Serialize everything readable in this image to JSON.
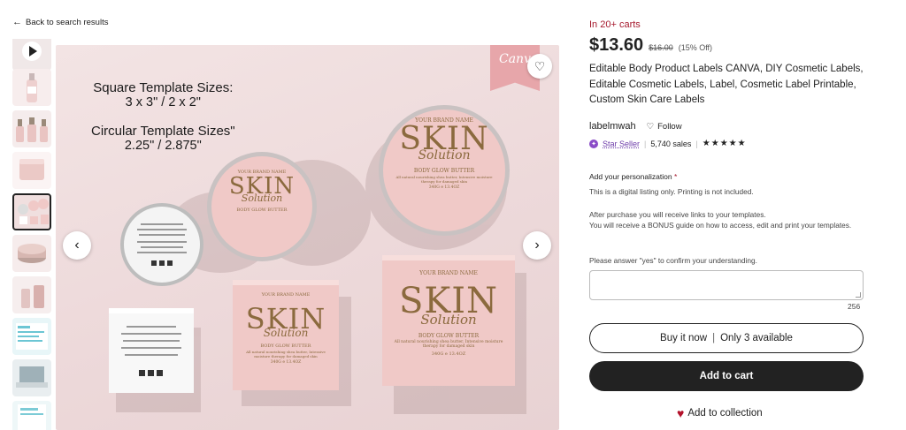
{
  "nav": {
    "back_label": "Back to search results"
  },
  "gallery": {
    "thumbnails": [
      {
        "name": "video-thumbnail"
      },
      {
        "name": "pump-bottle-thumbnail"
      },
      {
        "name": "dropper-bottles-thumbnail"
      },
      {
        "name": "jar-thumbnail"
      },
      {
        "name": "labels-thumbnail"
      },
      {
        "name": "tins-thumbnail"
      },
      {
        "name": "bottles-thumbnail"
      },
      {
        "name": "guide-thumbnail"
      },
      {
        "name": "laptop-thumbnail"
      },
      {
        "name": "doc-thumbnail"
      }
    ],
    "main_image": {
      "canva_text": "Canva",
      "line1": "Square Template Sizes:",
      "line2": "3 x 3\" / 2 x 2\"",
      "line3": "Circular Template Sizes\"",
      "line4": "2.25\" / 2.875\"",
      "label_brand": "YOUR BRAND NAME",
      "label_skin": "SKIN",
      "label_solution": "Solution",
      "label_product": "BODY GLOW BUTTER",
      "label_desc": "All natural nourishing shea butter, Intensive moisture therapy for damaged skin",
      "label_weight": "340G e 13.4OZ"
    }
  },
  "listing": {
    "carts_text": "In 20+ carts",
    "price": "$13.60",
    "original_price": "$16.00",
    "discount": "(15% Off)",
    "title": "Editable Body Product Labels CANVA, DIY Cosmetic Labels, Editable Cosmetic Labels, Label, Cosmetic Label Printable, Custom Skin Care Labels",
    "shop_name": "labelmwah",
    "follow_label": "Follow",
    "star_seller_label": "Star Seller",
    "sales": "5,740 sales",
    "stars": "★★★★★",
    "personalization_label": "Add your personalization",
    "required_mark": "*",
    "info1": "This is a digital listing only. Printing is not included.",
    "info2": "After purchase you will receive links to your templates.",
    "info3": "You will receive a BONUS guide on how to access, edit and print your templates.",
    "info4": "Please answer \"yes\" to confirm your understanding.",
    "char_counter": "256",
    "buy_now_label": "Buy it now",
    "buy_divider": "|",
    "availability": "Only 3 available",
    "add_to_cart_label": "Add to cart",
    "add_to_collection_label": "Add to collection"
  },
  "colors": {
    "accent_red": "#a61a2e",
    "star_seller_purple": "#8a4cc7",
    "label_pink": "#f0c9c7",
    "label_gold": "#8b6a3e",
    "dark_button": "#222222"
  }
}
